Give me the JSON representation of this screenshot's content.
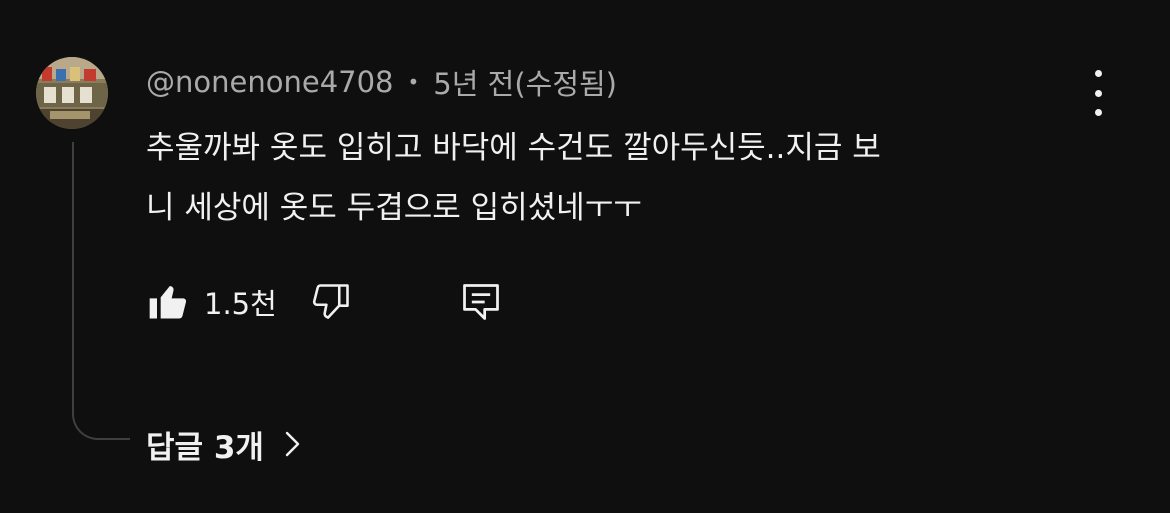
{
  "comment": {
    "author": "@nonenone4708",
    "separator": "•",
    "timestamp": "5년 전(수정됨)",
    "lines": [
      "추울까봐 옷도 입히고 바닥에 수건도 깔아두신듯..지금 보",
      "니 세상에 옷도 두겹으로 입히셨네ㅜㅜ"
    ],
    "likes": "1.5천",
    "replies_label": "답글 3개",
    "icons": {
      "avatar": "avatar-photo",
      "more": "more-vert-icon",
      "like": "thumb-up-icon",
      "dislike": "thumb-down-icon",
      "reply": "comment-reply-icon",
      "expand": "chevron-right-icon"
    }
  }
}
